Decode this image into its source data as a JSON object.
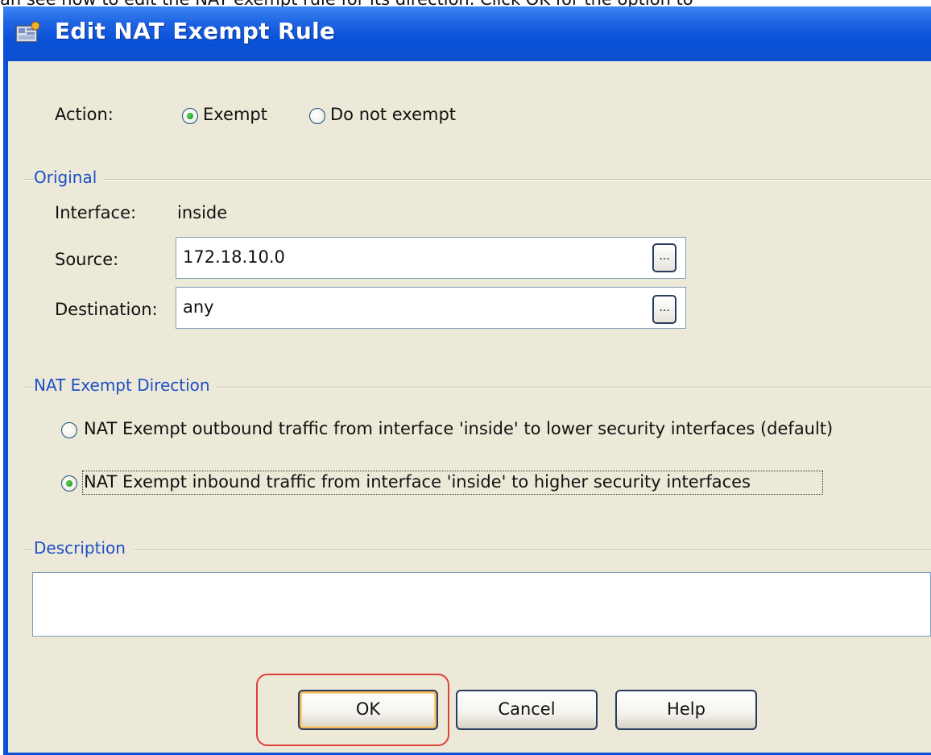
{
  "caption": "an see how to edit the NAT exempt rule for its direction. Click OK for the option to",
  "window": {
    "title": "Edit NAT Exempt Rule",
    "icon": "app-icon"
  },
  "action": {
    "label": "Action:",
    "options": [
      {
        "label": "Exempt",
        "selected": true
      },
      {
        "label": "Do not exempt",
        "selected": false
      }
    ]
  },
  "original": {
    "group_label": "Original",
    "interface_label": "Interface:",
    "interface_value": "inside",
    "source_label": "Source:",
    "source_value": "172.18.10.0",
    "destination_label": "Destination:",
    "destination_value": "any",
    "browse_label": "..."
  },
  "direction": {
    "group_label": "NAT Exempt Direction",
    "options": [
      {
        "label": "NAT Exempt outbound traffic from interface 'inside' to lower security interfaces (default)",
        "selected": false
      },
      {
        "label": "NAT Exempt inbound traffic from interface 'inside' to higher security interfaces",
        "selected": true
      }
    ]
  },
  "description": {
    "group_label": "Description",
    "value": ""
  },
  "buttons": {
    "ok": "OK",
    "cancel": "Cancel",
    "help": "Help"
  },
  "colors": {
    "titlebar": "#0a52d8",
    "dialog_bg": "#ece9d8",
    "group_label": "#1d4fc6",
    "highlight": "#e0403a"
  }
}
